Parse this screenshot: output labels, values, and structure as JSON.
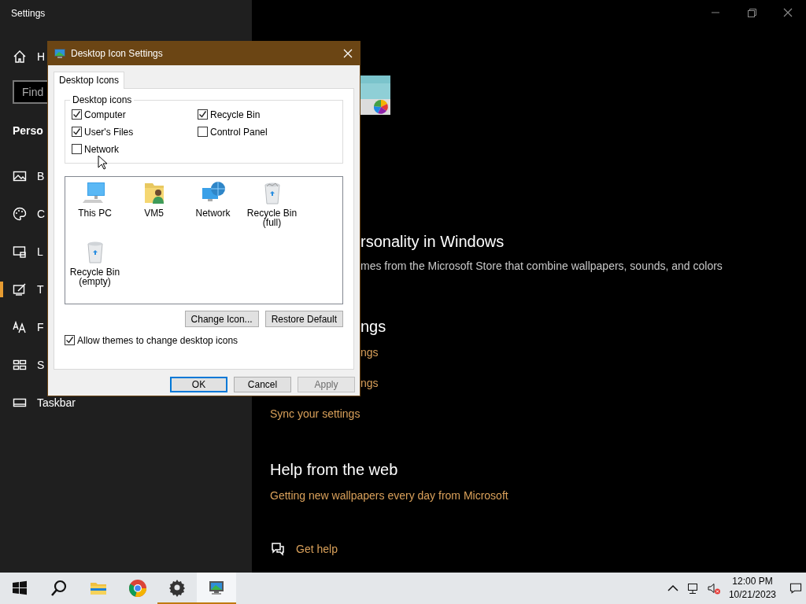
{
  "window": {
    "title": "Settings"
  },
  "sidebar": {
    "home": "H",
    "search": {
      "placeholder": "Find"
    },
    "section": "Perso",
    "items": [
      {
        "kind": "picture",
        "label": "B",
        "selected": false
      },
      {
        "kind": "palette",
        "label": "C",
        "selected": false
      },
      {
        "kind": "lock",
        "label": "L",
        "selected": false
      },
      {
        "kind": "themes",
        "label": "T",
        "selected": true
      },
      {
        "kind": "fonts",
        "label": "F",
        "selected": false
      },
      {
        "kind": "start",
        "label": "S",
        "selected": false
      },
      {
        "kind": "taskbar",
        "label": "Taskbar",
        "selected": false
      }
    ]
  },
  "content": [
    {
      "kind": "thumbnail"
    },
    {
      "kind": "heading",
      "text": "rsonality in Windows",
      "partly_hidden": true
    },
    {
      "kind": "description",
      "text": "mes from the Microsoft Store that combine wallpapers, sounds, and colors",
      "partly_hidden": true
    },
    {
      "kind": "heading",
      "text": "ngs",
      "partly_hidden": true
    },
    {
      "kind": "link",
      "text": "ngs",
      "partly_hidden": true
    },
    {
      "kind": "link",
      "text": "ngs",
      "partly_hidden": true
    },
    {
      "kind": "link",
      "text": "Sync your settings",
      "partly_hidden": false
    },
    {
      "kind": "heading",
      "text": "Help from the web",
      "partly_hidden": false
    },
    {
      "kind": "link",
      "text": "Getting new wallpapers every day from Microsoft",
      "partly_hidden": false
    },
    {
      "kind": "help",
      "text": "Get help"
    }
  ],
  "dialog": {
    "title": "Desktop Icon Settings",
    "tabs": [
      {
        "label": "Desktop Icons",
        "selected": true
      }
    ],
    "group": {
      "title": "Desktop icons",
      "options": [
        {
          "label": "Computer",
          "checked": true
        },
        {
          "label": "Recycle Bin",
          "checked": true
        },
        {
          "label": "User's Files",
          "checked": true
        },
        {
          "label": "Control Panel",
          "checked": false
        },
        {
          "label": "Network",
          "checked": false
        }
      ]
    },
    "icons": [
      {
        "kind": "pc",
        "label": "This PC",
        "selected": false
      },
      {
        "kind": "user",
        "label": "VM5",
        "selected": false
      },
      {
        "kind": "network",
        "label": "Network",
        "selected": false
      },
      {
        "kind": "bin-full",
        "label": "Recycle Bin (full)",
        "selected": false
      },
      {
        "kind": "bin-empty",
        "label": "Recycle Bin (empty)",
        "selected": false
      }
    ],
    "icon_buttons": [
      "Change Icon...",
      "Restore Default"
    ],
    "allow_themes": {
      "label": "Allow themes to change desktop icons",
      "checked": true
    },
    "buttons": [
      {
        "label": "OK",
        "default": true,
        "disabled": false
      },
      {
        "label": "Cancel",
        "default": false,
        "disabled": false
      },
      {
        "label": "Apply",
        "default": false,
        "disabled": true
      }
    ]
  },
  "taskbar": {
    "apps": [
      {
        "kind": "start",
        "running": false,
        "selected": false
      },
      {
        "kind": "search",
        "running": false,
        "selected": false
      },
      {
        "kind": "folder",
        "running": false,
        "selected": false
      },
      {
        "kind": "browser",
        "running": false,
        "selected": false
      },
      {
        "kind": "gear",
        "running": true,
        "selected": false
      },
      {
        "kind": "desktop-settings",
        "running": true,
        "selected": true
      }
    ],
    "time": "12:00 PM",
    "date": "10/21/2023"
  }
}
